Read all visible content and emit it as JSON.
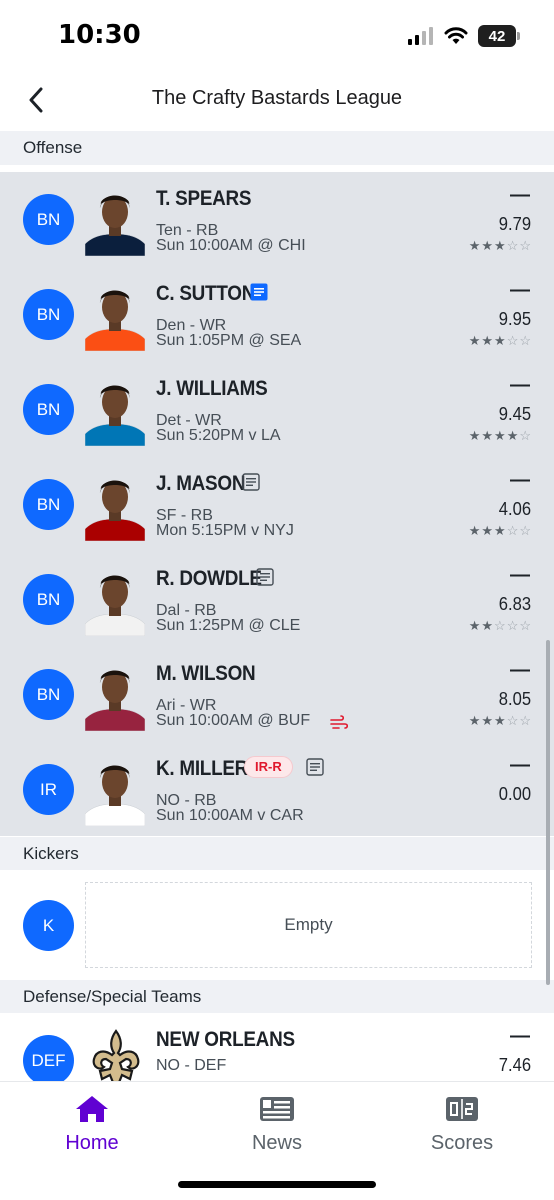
{
  "status_bar": {
    "time": "10:30",
    "battery": "42"
  },
  "header": {
    "title": "The Crafty Bastards League",
    "back_icon": "chevron-left-icon"
  },
  "sections": {
    "offense": "Offense",
    "kickers": "Kickers",
    "defense": "Defense/Special Teams"
  },
  "players": [
    {
      "slot": "BN",
      "name": "T. SPEARS",
      "team_pos": "Ten - RB",
      "game": "Sun 10:00AM @ CHI",
      "proj": "—",
      "points": "9.79",
      "stars": 3,
      "note": "none",
      "tag": "",
      "jersey": "#0b1f3d"
    },
    {
      "slot": "BN",
      "name": "C. SUTTON",
      "team_pos": "Den - WR",
      "game": "Sun 1:05PM @ SEA",
      "proj": "—",
      "points": "9.95",
      "stars": 3,
      "note": "new",
      "tag": "",
      "jersey": "#fb4f14"
    },
    {
      "slot": "BN",
      "name": "J. WILLIAMS",
      "team_pos": "Det - WR",
      "game": "Sun 5:20PM v LA",
      "proj": "—",
      "points": "9.45",
      "stars": 4,
      "note": "none",
      "tag": "",
      "jersey": "#0076b6"
    },
    {
      "slot": "BN",
      "name": "J. MASON",
      "team_pos": "SF - RB",
      "game": "Mon 5:15PM v NYJ",
      "proj": "—",
      "points": "4.06",
      "stars": 3,
      "note": "old",
      "tag": "",
      "jersey": "#aa0000"
    },
    {
      "slot": "BN",
      "name": "R. DOWDLE",
      "team_pos": "Dal - RB",
      "game": "Sun 1:25PM @ CLE",
      "proj": "—",
      "points": "6.83",
      "stars": 2,
      "note": "old",
      "tag": "",
      "jersey": "#f2f2f2"
    },
    {
      "slot": "BN",
      "name": "M. WILSON",
      "team_pos": "Ari - WR",
      "game": "Sun 10:00AM @ BUF",
      "proj": "—",
      "points": "8.05",
      "stars": 3,
      "note": "none",
      "tag": "",
      "jersey": "#97233f",
      "weather": "wind-icon"
    },
    {
      "slot": "IR",
      "name": "K. MILLER",
      "team_pos": "NO - RB",
      "game": "Sun 10:00AM v CAR",
      "proj": "—",
      "points": "0.00",
      "stars": 0,
      "note": "old",
      "tag": "IR-R",
      "jersey": "#ffffff"
    }
  ],
  "kicker": {
    "slot": "K",
    "empty_label": "Empty"
  },
  "defense": {
    "slot": "DEF",
    "name": "NEW ORLEANS",
    "team_pos": "NO - DEF",
    "proj": "—",
    "points": "7.46"
  },
  "tabs": [
    {
      "label": "Home",
      "icon": "home-icon",
      "active": true
    },
    {
      "label": "News",
      "icon": "news-icon",
      "active": false
    },
    {
      "label": "Scores",
      "icon": "scores-icon",
      "active": false
    }
  ],
  "colors": {
    "accent": "#6001d2",
    "badge": "#0f69ff",
    "tag_red": "#e0182d"
  }
}
